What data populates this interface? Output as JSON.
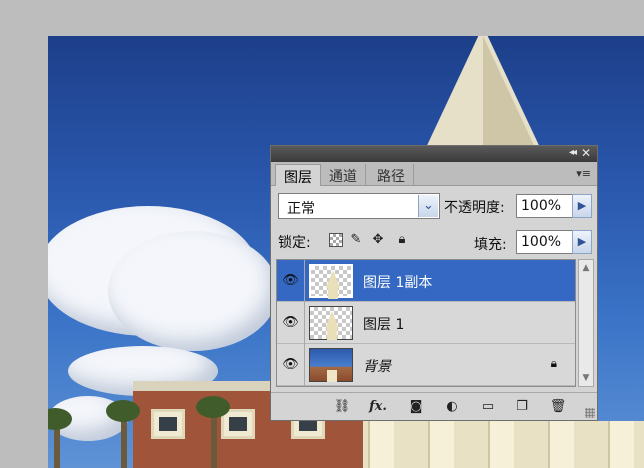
{
  "panel": {
    "tabs": [
      {
        "label": "图层",
        "active": true
      },
      {
        "label": "通道",
        "active": false
      },
      {
        "label": "路径",
        "active": false
      }
    ],
    "collapse_glyph": "◂◂",
    "close_glyph": "✕",
    "menu_glyph": "▾≡",
    "blend_mode": "正常",
    "opacity_label": "不透明度:",
    "opacity_value": "100%",
    "lock_label": "锁定:",
    "fill_label": "填充:",
    "fill_value": "100%",
    "layers": [
      {
        "name": "图层 1副本",
        "selected": true,
        "visible": true,
        "thumb": "transparent-steeple"
      },
      {
        "name": "图层 1",
        "selected": false,
        "visible": true,
        "thumb": "transparent"
      },
      {
        "name": "背景",
        "selected": false,
        "visible": true,
        "thumb": "photo",
        "locked": true
      }
    ],
    "bottom_icons": [
      "link-icon",
      "fx-icon",
      "mask-icon",
      "adjustment-icon",
      "folder-icon",
      "new-layer-icon",
      "trash-icon"
    ],
    "fx_label": "fx."
  },
  "colors": {
    "selection": "#3468c2",
    "panel_bg": "#d4d4d4",
    "accent_blue": "#2f5597"
  }
}
